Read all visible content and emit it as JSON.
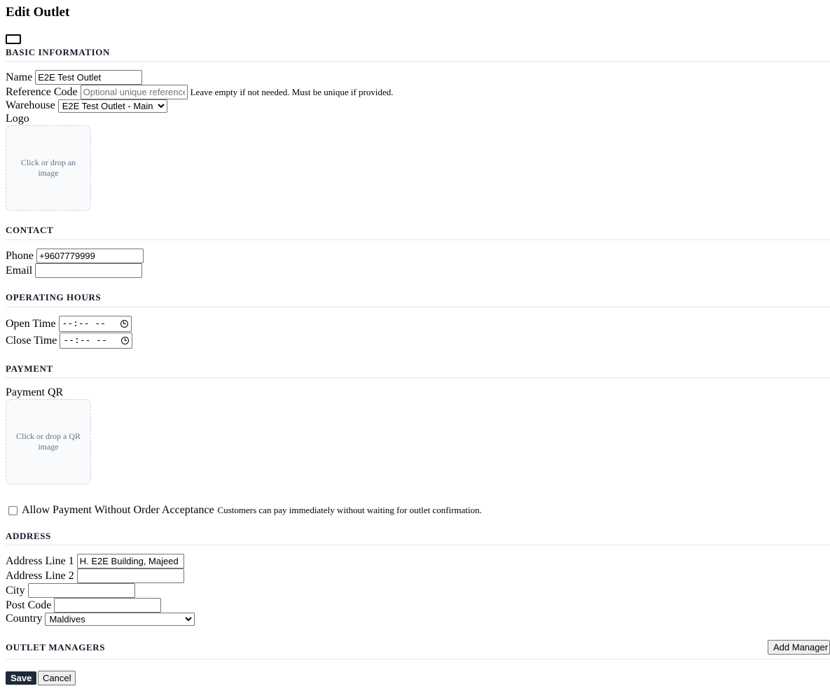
{
  "page": {
    "title": "Edit Outlet"
  },
  "basic": {
    "heading": "BASIC INFORMATION",
    "name_label": "Name",
    "name_value": "E2E Test Outlet",
    "ref_label": "Reference Code",
    "ref_placeholder": "Optional unique reference",
    "ref_hint": "Leave empty if not needed. Must be unique if provided.",
    "warehouse_label": "Warehouse",
    "warehouse_value": "E2E Test Outlet - Main",
    "logo_label": "Logo",
    "logo_drop": "Click or drop an image"
  },
  "contact": {
    "heading": "CONTACT",
    "phone_label": "Phone",
    "phone_value": "+9607779999",
    "email_label": "Email",
    "email_value": ""
  },
  "hours": {
    "heading": "OPERATING HOURS",
    "open_label": "Open Time",
    "open_value": "--:-- --",
    "close_label": "Close Time",
    "close_value": "--:-- --"
  },
  "payment": {
    "heading": "PAYMENT",
    "qr_label": "Payment QR",
    "qr_drop": "Click or drop a QR image",
    "allow_label": "Allow Payment Without Order Acceptance",
    "allow_hint": "Customers can pay immediately without waiting for outlet confirmation.",
    "allow_checked": false
  },
  "address": {
    "heading": "ADDRESS",
    "line1_label": "Address Line 1",
    "line1_value": "H. E2E Building, Majeed",
    "line2_label": "Address Line 2",
    "line2_value": "",
    "city_label": "City",
    "city_value": "",
    "postcode_label": "Post Code",
    "postcode_value": "",
    "country_label": "Country",
    "country_value": "Maldives"
  },
  "managers": {
    "heading": "OUTLET MANAGERS",
    "add_label": "Add Manager"
  },
  "actions": {
    "save_label": "Save",
    "cancel_label": "Cancel"
  }
}
